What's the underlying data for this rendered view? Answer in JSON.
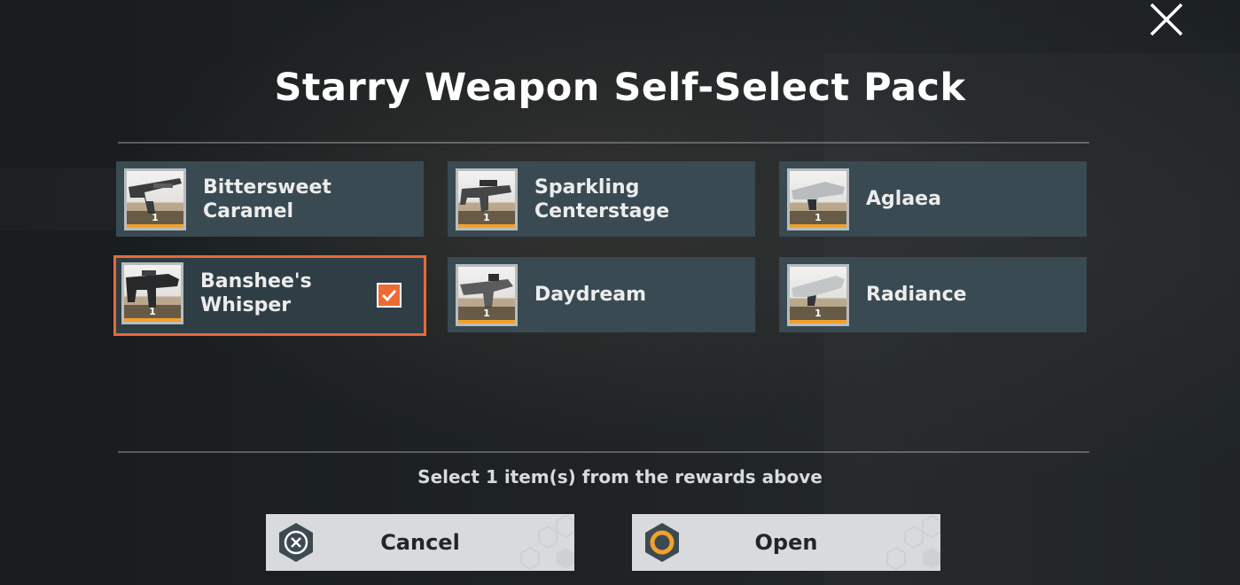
{
  "dialog": {
    "title": "Starry Weapon Self-Select Pack",
    "hint": "Select 1 item(s) from the rewards above"
  },
  "items": [
    {
      "name": "Bittersweet Caramel",
      "count": "1",
      "selected": false
    },
    {
      "name": "Sparkling Centerstage",
      "count": "1",
      "selected": false
    },
    {
      "name": "Aglaea",
      "count": "1",
      "selected": false
    },
    {
      "name": "Banshee's Whisper",
      "count": "1",
      "selected": true
    },
    {
      "name": "Daydream",
      "count": "1",
      "selected": false
    },
    {
      "name": "Radiance",
      "count": "1",
      "selected": false
    }
  ],
  "buttons": {
    "cancel_label": "Cancel",
    "open_label": "Open"
  },
  "colors": {
    "accent": "#e8693a",
    "card_bg": "#394a52",
    "button_bg": "#d8dadc",
    "rarity_bar": "#f2a12b"
  },
  "icons": {
    "close": "close-icon",
    "cancel": "cancel-x-icon",
    "open": "open-ring-icon",
    "check": "checkmark-icon"
  }
}
